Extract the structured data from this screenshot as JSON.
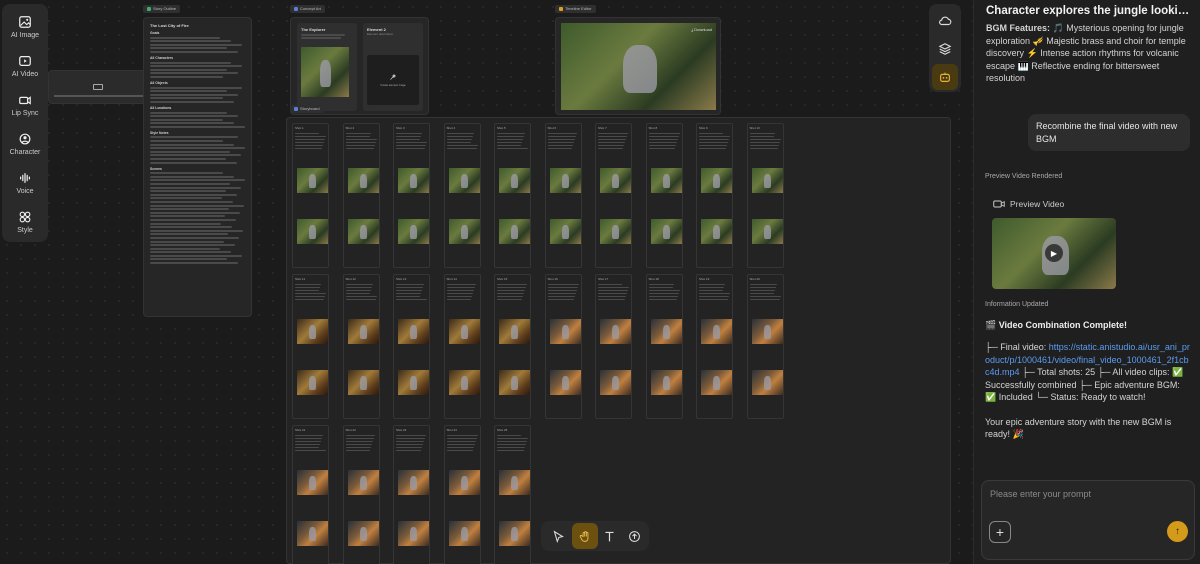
{
  "sidebar": {
    "items": [
      {
        "label": "AI Image",
        "icon": "image-icon"
      },
      {
        "label": "AI Video",
        "icon": "video-icon"
      },
      {
        "label": "Lip Sync",
        "icon": "lip-sync-icon"
      },
      {
        "label": "Character",
        "icon": "character-icon"
      },
      {
        "label": "Voice",
        "icon": "voice-icon"
      },
      {
        "label": "Style",
        "icon": "style-icon"
      }
    ]
  },
  "nodes": {
    "story_outline": {
      "tag": "Story Outline",
      "title": "The Lost City of Fire",
      "sections": [
        "Goals",
        "All Characters",
        "All Objects",
        "All Locations",
        "Style Notes",
        "Scenes"
      ]
    },
    "concept_art": {
      "tag": "Concept Art",
      "element1": "The Explorer",
      "element2": "Element 2",
      "element2_sub": "Element description",
      "element2_action": "Create element image"
    },
    "timeline_editor": {
      "tag": "Timeline Editor",
      "download": "Download"
    },
    "storyboard": {
      "tag": "Storyboard"
    }
  },
  "shots": [
    "Shot 1",
    "Shot 2",
    "Shot 3",
    "Shot 4",
    "Shot 5",
    "Shot 6",
    "Shot 7",
    "Shot 8",
    "Shot 9",
    "Shot 10",
    "Shot 11",
    "Shot 12",
    "Shot 13",
    "Shot 14",
    "Shot 15",
    "Shot 16",
    "Shot 17",
    "Shot 18",
    "Shot 19",
    "Shot 20",
    "Shot 21",
    "Shot 22",
    "Shot 23",
    "Shot 24",
    "Shot 25"
  ],
  "chat": {
    "title": "Character explores the jungle looking f...",
    "bgm_heading": "BGM Features:",
    "bgm_text": "🎵 Mysterious opening for jungle exploration 🎺 Majestic brass and choir for temple discovery ⚡ Intense action rhythms for volcanic escape 🎹 Reflective ending for bittersweet resolution",
    "user_message": "Recombine the final video with new BGM",
    "preview_rendered_label": "Preview Video Rendered",
    "preview_button": "Preview Video",
    "info_updated_label": "Information Updated",
    "complete_heading": "🎬 Video Combination Complete!",
    "final_video_prefix": "├─ Final video:",
    "final_video_url": "https://static.anistudio.ai/usr_ani_product/p/1000461/video/final_video_1000461_2f1cbc4d.mp4",
    "details": "├─ Total shots: 25 ├─ All video clips: ✅ Successfully combined ├─ Epic adventure BGM: ✅ Included └─ Status: Ready to watch!",
    "closing": "Your epic adventure story with the new BGM is ready! 🎉",
    "prompt_placeholder": "Please enter your prompt"
  },
  "colors": {
    "accent": "#d49a1a",
    "link": "#5a9cf0",
    "story_tag": "#3fae6a",
    "concept_tag": "#5a7de0",
    "timeline_tag": "#e0a020"
  }
}
